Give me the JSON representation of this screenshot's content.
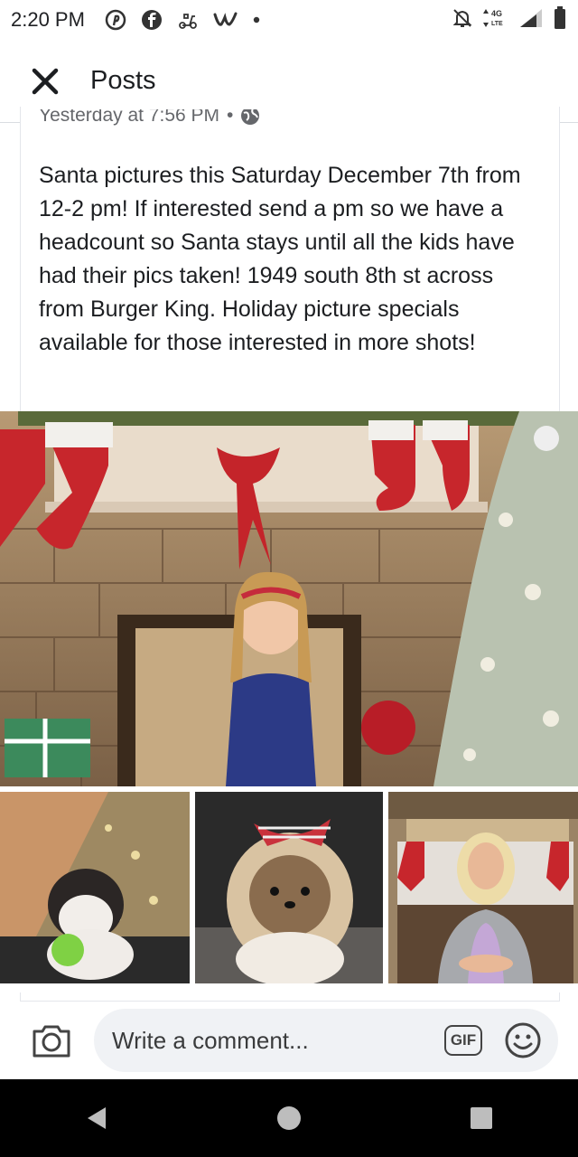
{
  "status_bar": {
    "time": "2:20 PM",
    "network": "4G LTE",
    "left_icons": [
      "pinterest-icon",
      "facebook-icon",
      "scooter-icon",
      "wish-icon",
      "dot-icon"
    ],
    "right_icons": [
      "mute-icon",
      "data-arrows-icon",
      "signal-icon",
      "battery-icon"
    ]
  },
  "header": {
    "title": "Posts"
  },
  "post": {
    "timestamp": "Yesterday at 7:56 PM",
    "separator": "•",
    "text": "Santa pictures this Saturday December 7th from 12-2 pm! If interested send a pm so we have a headcount so Santa stays until all the kids have had their pics taken! 1949 south 8th st across from Burger King. Holiday picture specials available for those interested in more shots!"
  },
  "images": {
    "main": "girl-christmas-fireplace-photo",
    "thumbnails": [
      "shih-tzu-christmas-tree-photo",
      "shih-tzu-plaid-bow-photo",
      "woman-christmas-fireplace-photo"
    ]
  },
  "comment_bar": {
    "placeholder": "Write a comment...",
    "gif_label": "GIF"
  },
  "nav_bar": {
    "buttons": [
      "back-icon",
      "home-icon",
      "recents-icon"
    ]
  },
  "colors": {
    "text": "#1c1e21",
    "secondary_text": "#65676b",
    "input_bg": "#f0f2f5",
    "nav_bar_bg": "#000000"
  }
}
